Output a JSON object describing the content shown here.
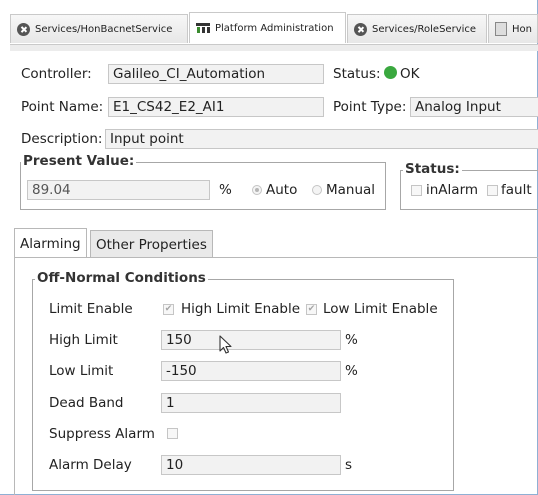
{
  "tabs": [
    {
      "label": "Services/HonBacnetService",
      "icon": "close-icon"
    },
    {
      "label": "Platform Administration",
      "icon": "platform-admin-icon"
    },
    {
      "label": "Services/RoleService",
      "icon": "close-icon"
    },
    {
      "label": "Hon",
      "icon": "document-icon"
    }
  ],
  "controller": {
    "label": "Controller:",
    "value": "Galileo_CI_Automation"
  },
  "status": {
    "label": "Status:",
    "value": "OK",
    "color": "#3aa83f"
  },
  "point_name": {
    "label": "Point Name:",
    "value": "E1_CS42_E2_AI1"
  },
  "point_type": {
    "label": "Point Type:",
    "value": "Analog Input"
  },
  "description": {
    "label": "Description:",
    "value": "Input point"
  },
  "present_value": {
    "legend": "Present Value:",
    "value": "89.04",
    "unit": "%",
    "auto_label": "Auto",
    "manual_label": "Manual",
    "selected": "Auto"
  },
  "status_group": {
    "legend": "Status:",
    "in_alarm_label": "inAlarm",
    "fault_label": "fault"
  },
  "panel_tabs": [
    {
      "label": "Alarming",
      "active": true
    },
    {
      "label": "Other Properties",
      "active": false
    }
  ],
  "off_normal": {
    "legend": "Off-Normal Conditions",
    "limit_enable_label": "Limit Enable",
    "high_limit_enable_label": "High Limit Enable",
    "low_limit_enable_label": "Low Limit Enable",
    "high_limit_label": "High Limit",
    "high_limit_value": "150",
    "high_limit_unit": "%",
    "low_limit_label": "Low Limit",
    "low_limit_value": "-150",
    "low_limit_unit": "%",
    "dead_band_label": "Dead Band",
    "dead_band_value": "1",
    "suppress_alarm_label": "Suppress Alarm",
    "alarm_delay_label": "Alarm Delay",
    "alarm_delay_value": "10",
    "alarm_delay_unit": "s"
  }
}
